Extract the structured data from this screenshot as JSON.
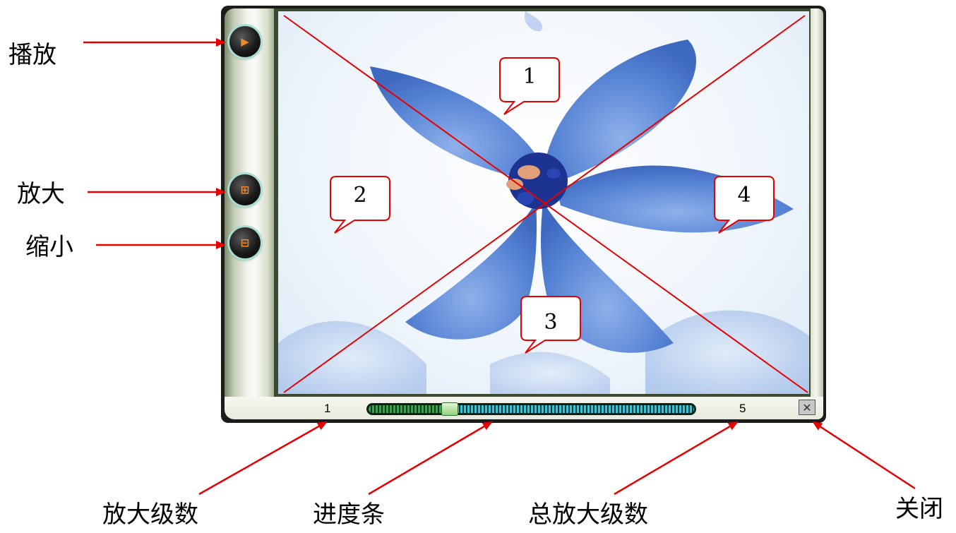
{
  "labels": {
    "play": "播放",
    "zoom_in": "放大",
    "zoom_out": "缩小",
    "zoom_level": "放大级数",
    "progress_bar": "进度条",
    "total_zoom_levels": "总放大级数",
    "close": "关闭"
  },
  "viewer": {
    "current_level": "1",
    "total_levels": "5",
    "progress": 0.25,
    "close_glyph": "✕"
  },
  "callouts": [
    "1",
    "2",
    "3",
    "4"
  ],
  "colors": {
    "annotation_red": "#e60000",
    "accent_orange": "#f08a2a",
    "petal_blue": "#5a86d6"
  },
  "icons": {
    "play": "play-icon",
    "zoom_in": "zoom-in-icon",
    "zoom_out": "zoom-out-icon",
    "close": "close-icon"
  }
}
